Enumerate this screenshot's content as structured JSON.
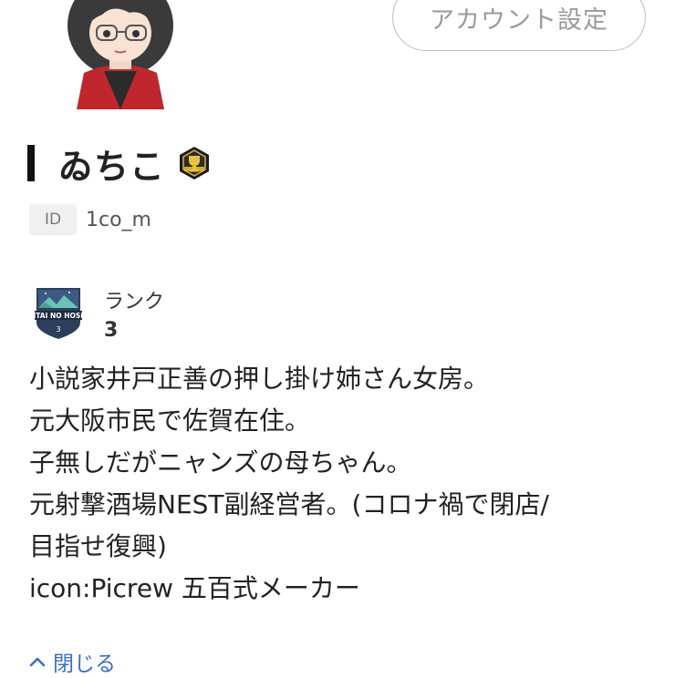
{
  "header": {
    "account_settings_label": "アカウント設定"
  },
  "profile": {
    "display_name": "ゐちこ",
    "badge_icon": "top-fan-badge",
    "id_label": "ID",
    "id_value": "1co_m"
  },
  "rank": {
    "label": "ランク",
    "value": "3",
    "emblem_icon": "kitai-no-hoshi-emblem",
    "emblem_text": "KITAI NO HOSHI",
    "emblem_level": "3"
  },
  "bio": {
    "lines": [
      "小説家井戸正善の押し掛け姉さん女房。",
      "元大阪市民で佐賀在住。",
      "子無しだがニャンズの母ちゃん。",
      "元射撃酒場NEST副経営者。(コロナ禍で閉店/",
      "目指せ復興)",
      "icon:Picrew 五百式メーカー"
    ]
  },
  "footer": {
    "close_label": "閉じる",
    "close_icon": "chevron-up-icon"
  },
  "colors": {
    "link": "#3b6cc8",
    "text": "#222222",
    "muted": "#9a9a9a"
  }
}
